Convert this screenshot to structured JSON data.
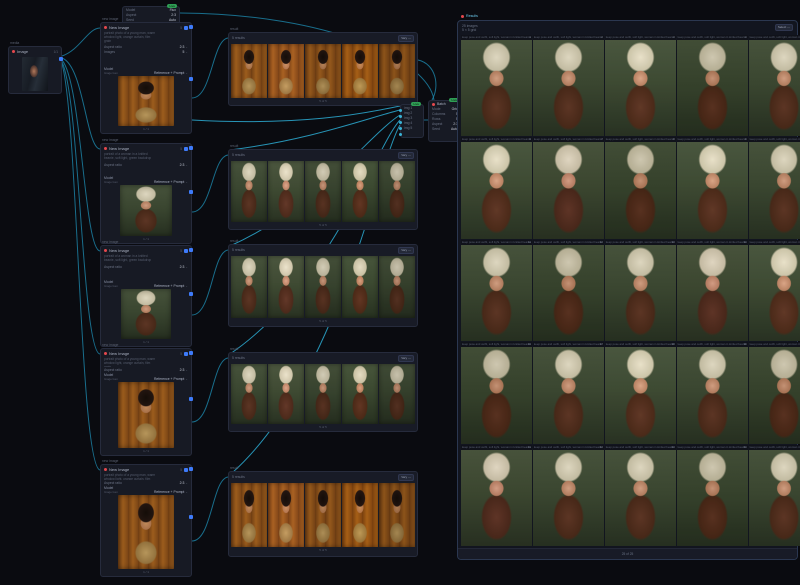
{
  "icons": {
    "chevron": "⌄",
    "more": "⋯",
    "dot": "•"
  },
  "source_node": {
    "pretitle": "media",
    "title": "Image",
    "meta": "1/1"
  },
  "settings_node": {
    "badge": "Live",
    "rows": [
      {
        "l": "Model",
        "v": "Flux"
      },
      {
        "l": "Aspect",
        "v": "2:3"
      },
      {
        "l": "Seed",
        "v": "Auto"
      }
    ]
  },
  "gen_nodes": [
    {
      "pretitle": "new image",
      "title": "New Image",
      "meta": "5",
      "prompt": "portrait photo of a young man, warm window light, orange curtain, film grain",
      "params": [
        {
          "l": "Aspect ratio",
          "v": "2:3"
        },
        {
          "l": "Images",
          "v": "5"
        }
      ],
      "footer_left": "Model",
      "footer_left_sub": "Image Gen",
      "footer_right": "Reference + Prompt",
      "caption": "1 / 1",
      "portrait": "man"
    },
    {
      "pretitle": "new image",
      "title": "New Image",
      "meta": "5",
      "prompt": "portrait of a woman in a knitted beanie, soft light, green backdrop",
      "params": [
        {
          "l": "Aspect ratio",
          "v": "2:3"
        },
        {
          "l": "Images",
          "v": "5"
        }
      ],
      "footer_left": "Model",
      "footer_left_sub": "Image Gen",
      "footer_right": "Reference + Prompt",
      "caption": "1 / 1",
      "portrait": "woman"
    },
    {
      "pretitle": "new image",
      "title": "New Image",
      "meta": "5",
      "prompt": "portrait of a woman in a knitted beanie, soft light, green backdrop",
      "params": [
        {
          "l": "Aspect ratio",
          "v": "2:3"
        },
        {
          "l": "Images",
          "v": "5"
        }
      ],
      "footer_left": "Model",
      "footer_left_sub": "Image Gen",
      "footer_right": "Reference + Prompt",
      "caption": "1 / 1",
      "portrait": "woman"
    },
    {
      "pretitle": "new image",
      "title": "New Image",
      "meta": "5",
      "prompt": "portrait photo of a young man, warm window light, orange curtain, film grain",
      "params": [
        {
          "l": "Aspect ratio",
          "v": "2:3"
        },
        {
          "l": "Images",
          "v": "5"
        }
      ],
      "footer_left": "Model",
      "footer_left_sub": "Image Gen",
      "footer_right": "Reference + Prompt",
      "caption": "1 / 1",
      "portrait": "man"
    },
    {
      "pretitle": "new image",
      "title": "New Image",
      "meta": "5",
      "prompt": "portrait photo of a young man, warm window light, orange curtain, film grain",
      "params": [
        {
          "l": "Aspect ratio",
          "v": "2:3"
        },
        {
          "l": "Images",
          "v": "5"
        }
      ],
      "footer_left": "Model",
      "footer_left_sub": "Image Gen",
      "footer_right": "Reference + Prompt",
      "caption": "1 / 1",
      "portrait": "man"
    }
  ],
  "strips": [
    {
      "pretitle": "result",
      "title": "New Image",
      "header": "5 results",
      "action": "Vary ⋯",
      "footer": "5 of 5",
      "portrait": "man",
      "count": 5
    },
    {
      "pretitle": "result",
      "title": "New Image",
      "header": "5 results",
      "action": "Vary ⋯",
      "footer": "5 of 5",
      "portrait": "woman",
      "count": 5
    },
    {
      "pretitle": "result",
      "title": "New Image",
      "header": "5 results",
      "action": "Vary ⋯",
      "footer": "5 of 5",
      "portrait": "woman",
      "count": 5
    },
    {
      "pretitle": "result",
      "title": "New Image",
      "header": "5 results",
      "action": "Vary ⋯",
      "footer": "5 of 5",
      "portrait": "woman",
      "count": 5
    },
    {
      "pretitle": "result",
      "title": "New Image",
      "header": "5 results",
      "action": "Vary ⋯",
      "footer": "5 of 5",
      "portrait": "man",
      "count": 5
    }
  ],
  "router_left": {
    "badge": "Live",
    "rows": [
      "img 1",
      "img 2",
      "img 3",
      "img 4",
      "img 5"
    ]
  },
  "router_right": {
    "title": "Batch",
    "badge": "Live",
    "rows": [
      {
        "l": "Mode",
        "v": "Grid"
      },
      {
        "l": "Columns",
        "v": "5"
      },
      {
        "l": "Rows",
        "v": "5"
      },
      {
        "l": "Aspect",
        "v": "2:3"
      },
      {
        "l": "Seed",
        "v": "Auto"
      }
    ]
  },
  "grid_node": {
    "title": "Results",
    "header": "25 images",
    "sub": "5 × 5 grid",
    "action": "Select ⋯",
    "tile_caption": "keep pose and outfit, soft light, woman in knitted beanie",
    "footer": "25 of 25",
    "rows": 5,
    "cols": 5,
    "portrait": "woman"
  },
  "colors": {
    "edge": "#1d87ab",
    "accent_red": "#e5484d",
    "accent_blue": "#3e7bfa",
    "badge_green": "#2f9e55"
  }
}
